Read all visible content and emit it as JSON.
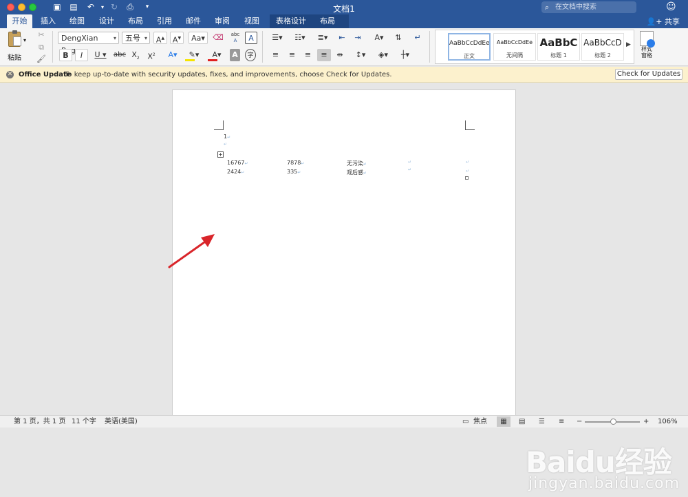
{
  "window": {
    "title": "文档1",
    "search_placeholder": "在文档中搜索",
    "share_label": "共享"
  },
  "tabs": [
    "开始",
    "插入",
    "绘图",
    "设计",
    "布局",
    "引用",
    "邮件",
    "审阅",
    "视图",
    "表格设计",
    "布局"
  ],
  "ribbon": {
    "paste_label": "粘贴",
    "font_name": "DengXian Reg...",
    "font_size": "五号",
    "styles": [
      {
        "preview": "AaBbCcDdEe",
        "name": "正文"
      },
      {
        "preview": "AaBbCcDdEe",
        "name": "无间隔"
      },
      {
        "preview": "AaBbC",
        "name": "标题 1"
      },
      {
        "preview": "AaBbCcD",
        "name": "标题 2"
      }
    ],
    "styles_pane_label": "样式\n窗格"
  },
  "notification": {
    "title": "Office Update",
    "message": "To keep up-to-date with security updates, fixes, and improvements, choose Check for Updates.",
    "button_label": "Check for Updates"
  },
  "document": {
    "line1": "1",
    "table_rows": [
      [
        "16767",
        "7878",
        "无污染"
      ],
      [
        "2424",
        "335",
        "观后感"
      ]
    ]
  },
  "status": {
    "page_info": "第 1 页，共 1 页",
    "word_count": "11 个字",
    "language": "英语(美国)",
    "focus_label": "焦点",
    "zoom": "106%"
  },
  "watermark": {
    "logo": "Baidu经验",
    "url": "jingyan.baidu.com"
  },
  "colors": {
    "titlebar": "#2b579a",
    "notify_bg": "#fcf1cd",
    "arrow": "#d9252a",
    "font_color_bar": "#e02020",
    "highlight_bar": "#f5e400"
  }
}
